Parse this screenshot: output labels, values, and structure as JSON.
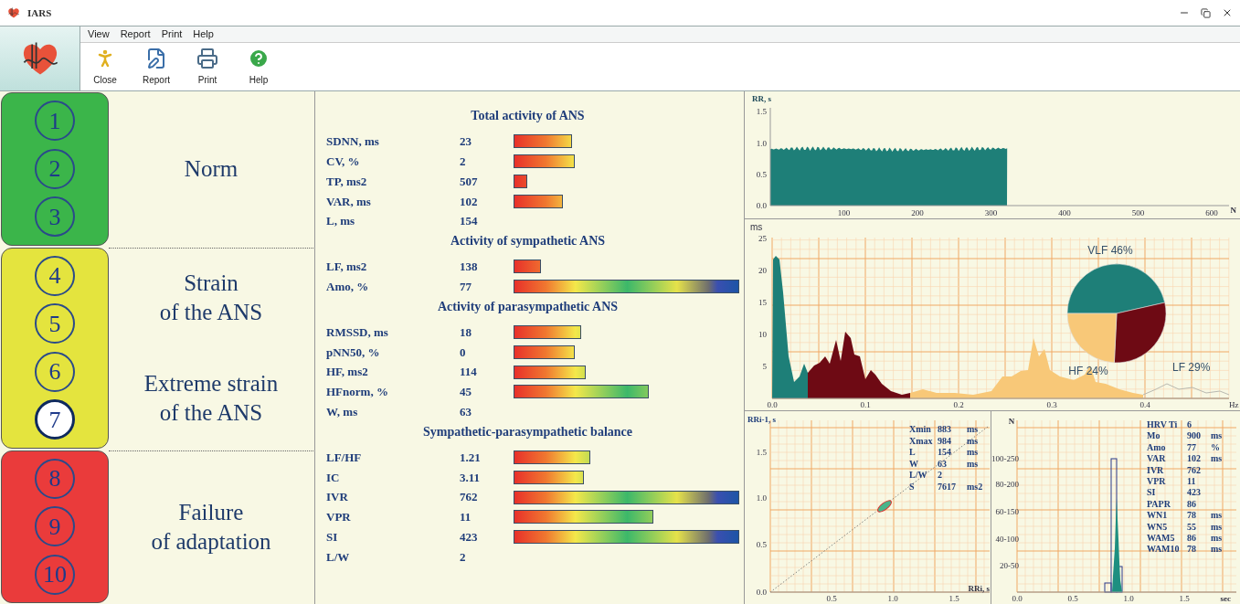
{
  "window": {
    "title": "IARS"
  },
  "menu": [
    "View",
    "Report",
    "Print",
    "Help"
  ],
  "toolbar": [
    {
      "kind": "close",
      "label": "Close"
    },
    {
      "kind": "report",
      "label": "Report"
    },
    {
      "kind": "print",
      "label": "Print"
    },
    {
      "kind": "help",
      "label": "Help"
    }
  ],
  "scale": [
    {
      "color": "#3bb54a",
      "labels": [
        "Norm"
      ],
      "levels": [
        {
          "number": "1",
          "selected": false
        },
        {
          "number": "2",
          "selected": false
        },
        {
          "number": "3",
          "selected": false
        }
      ]
    },
    {
      "color": "#e4e43e",
      "labels": [
        "Strain\nof  the ANS",
        "Extreme strain\nof the ANS"
      ],
      "levels": [
        {
          "number": "4",
          "selected": false
        },
        {
          "number": "5",
          "selected": false
        },
        {
          "number": "6",
          "selected": false
        },
        {
          "number": "7",
          "selected": true
        }
      ]
    },
    {
      "color": "#ea3b3b",
      "labels": [
        "Failure\nof adaptation"
      ],
      "levels": [
        {
          "number": "8",
          "selected": false
        },
        {
          "number": "9",
          "selected": false
        },
        {
          "number": "10",
          "selected": false
        }
      ]
    }
  ],
  "sections": [
    {
      "title": "Total activity of ANS",
      "rows": [
        {
          "kind": "bar",
          "label": "SDNN, ms",
          "value": "23"
        },
        {
          "kind": "bar",
          "label": "CV, %",
          "value": "2"
        },
        {
          "kind": "bar",
          "label": "TP, ms2",
          "value": "507"
        },
        {
          "kind": "bar",
          "label": "VAR, ms",
          "value": "102"
        },
        {
          "kind": "value",
          "label": "L, ms",
          "value": "154"
        }
      ]
    },
    {
      "title": "Activity of sympathetic ANS",
      "rows": [
        {
          "kind": "bar",
          "label": "LF, ms2",
          "value": "138"
        },
        {
          "kind": "bar",
          "label": "Amo, %",
          "value": "77"
        }
      ]
    },
    {
      "title": "Activity of parasympathetic ANS",
      "rows": [
        {
          "kind": "bar",
          "label": "RMSSD, ms",
          "value": "18"
        },
        {
          "kind": "bar",
          "label": "pNN50, %",
          "value": "0"
        },
        {
          "kind": "bar",
          "label": "HF, ms2",
          "value": "114"
        },
        {
          "kind": "bar",
          "label": "HFnorm, %",
          "value": "45"
        },
        {
          "kind": "value",
          "label": "W, ms",
          "value": "63"
        }
      ]
    },
    {
      "title": "Sympathetic-parasympathetic balance",
      "rows": [
        {
          "kind": "bar",
          "label": "LF/HF",
          "value": "1.21"
        },
        {
          "kind": "bar",
          "label": "IC",
          "value": "3.11"
        },
        {
          "kind": "bar",
          "label": "IVR",
          "value": "762"
        },
        {
          "kind": "bar",
          "label": "VPR",
          "value": "11"
        },
        {
          "kind": "bar",
          "label": "SI",
          "value": "423"
        },
        {
          "kind": "value",
          "label": "L/W",
          "value": "2"
        }
      ]
    }
  ],
  "rr_chart": {
    "y_label": "RR, s",
    "y_ticks": [
      "1.5",
      "1.0",
      "0.5",
      "0.0"
    ],
    "x_ticks": [
      "100",
      "200",
      "300",
      "400",
      "500",
      "600"
    ],
    "x_label": "N"
  },
  "spectrum": {
    "y_label": "ms",
    "y_ticks": [
      "25",
      "20",
      "15",
      "10",
      "5"
    ],
    "x_ticks": [
      "0.0",
      "0.1",
      "0.2",
      "0.3",
      "0.4"
    ],
    "x_label": "Hz",
    "chart_data": {
      "type": "pie",
      "categories": [
        "VLF",
        "LF",
        "HF"
      ],
      "values": [
        46,
        29,
        24
      ],
      "value_labels": [
        "46%",
        "29%",
        "24%"
      ]
    }
  },
  "scatter": {
    "y_label": "RRi-1, s",
    "x_label": "RRi, s",
    "y_ticks": [
      "1.5",
      "1.0",
      "0.5",
      "0.0"
    ],
    "x_ticks": [
      "0.5",
      "1.0",
      "1.5"
    ],
    "stats": [
      {
        "name": "Xmin",
        "value": "883",
        "unit": "ms"
      },
      {
        "name": "Xmax",
        "value": "984",
        "unit": "ms"
      },
      {
        "name": "L",
        "value": "154",
        "unit": "ms"
      },
      {
        "name": "W",
        "value": "63",
        "unit": "ms"
      },
      {
        "name": "L/W",
        "value": "2"
      },
      {
        "name": "S",
        "value": "7617",
        "unit": "ms2"
      }
    ]
  },
  "histogram": {
    "y_label": "N",
    "y_ticks": [
      "100-250",
      "80-200",
      "60-150",
      "40-100",
      "20-50"
    ],
    "x_ticks": [
      "0.0",
      "0.5",
      "1.0",
      "1.5"
    ],
    "x_label": "sec",
    "stats": [
      {
        "name": "HRV Ti",
        "value": "6"
      },
      {
        "name": "Mo",
        "value": "900",
        "unit": "ms"
      },
      {
        "name": "Amo",
        "value": "77",
        "unit": "%"
      },
      {
        "name": "VAR",
        "value": "102",
        "unit": "ms"
      },
      {
        "name": "IVR",
        "value": "762"
      },
      {
        "name": "VPR",
        "value": "11"
      },
      {
        "name": "SI",
        "value": "423"
      },
      {
        "name": "PAPR",
        "value": "86"
      },
      {
        "name": "WN1",
        "value": "78",
        "unit": "ms"
      },
      {
        "name": "WN5",
        "value": "55",
        "unit": "ms"
      },
      {
        "name": "WAM5",
        "value": "86",
        "unit": "ms"
      },
      {
        "name": "WAM10",
        "value": "78",
        "unit": "ms"
      }
    ]
  }
}
